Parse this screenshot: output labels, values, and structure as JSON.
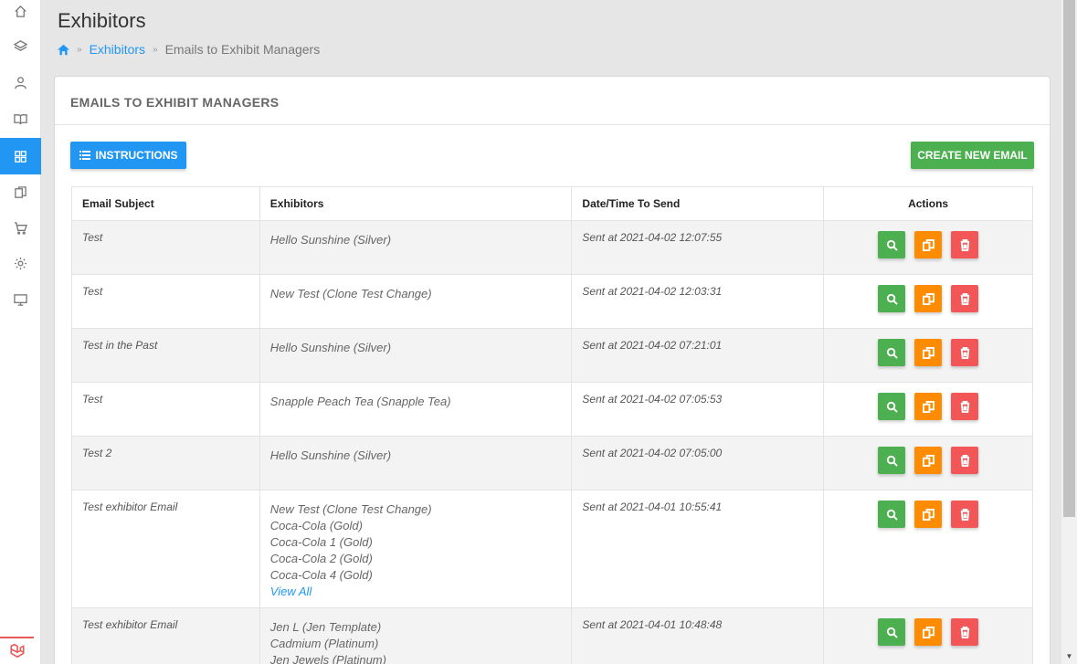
{
  "header": {
    "title": "Exhibitors",
    "breadcrumb": {
      "section": "Exhibitors",
      "current": "Emails to Exhibit Managers"
    }
  },
  "sidebar": {
    "items": [
      {
        "icon": "home-icon"
      },
      {
        "icon": "layers-icon"
      },
      {
        "icon": "user-icon"
      },
      {
        "icon": "book-icon"
      },
      {
        "icon": "grid-icon",
        "active": true
      },
      {
        "icon": "copy-icon"
      },
      {
        "icon": "cart-icon"
      },
      {
        "icon": "gear-icon"
      },
      {
        "icon": "monitor-icon"
      }
    ],
    "logo": "laravel-logo-icon"
  },
  "card": {
    "title": "EMAILS TO EXHIBIT MANAGERS",
    "instructions_label": "INSTRUCTIONS",
    "create_label": "CREATE NEW EMAIL"
  },
  "table": {
    "columns": [
      "Email Subject",
      "Exhibitors",
      "Date/Time To Send",
      "Actions"
    ],
    "rows": [
      {
        "subject": "Test",
        "exhibitors": [
          "Hello Sunshine (Silver)"
        ],
        "sent": "Sent at 2021-04-02 12:07:55"
      },
      {
        "subject": "Test",
        "exhibitors": [
          "New Test (Clone Test Change)"
        ],
        "sent": "Sent at 2021-04-02 12:03:31"
      },
      {
        "subject": "Test in the Past",
        "exhibitors": [
          "Hello Sunshine (Silver)"
        ],
        "sent": "Sent at 2021-04-02 07:21:01"
      },
      {
        "subject": "Test",
        "exhibitors": [
          "Snapple Peach Tea (Snapple Tea)"
        ],
        "sent": "Sent at 2021-04-02 07:05:53"
      },
      {
        "subject": "Test 2",
        "exhibitors": [
          "Hello Sunshine (Silver)"
        ],
        "sent": "Sent at 2021-04-02 07:05:00"
      },
      {
        "subject": "Test exhibitor Email",
        "exhibitors": [
          "New Test (Clone Test Change)",
          "Coca-Cola (Gold)",
          "Coca-Cola 1 (Gold)",
          "Coca-Cola 2 (Gold)",
          "Coca-Cola 4 (Gold)"
        ],
        "view_all": "View All",
        "sent": "Sent at 2021-04-01 10:55:41"
      },
      {
        "subject": "Test exhibitor Email",
        "exhibitors": [
          "Jen L (Jen Template)",
          "Cadmium (Platinum)",
          "Jen Jewels (Platinum)"
        ],
        "sent": "Sent at 2021-04-01 10:48:48"
      }
    ]
  },
  "colors": {
    "primary": "#2196f3",
    "success": "#4caf50",
    "warning": "#ff8c00",
    "danger": "#f25656"
  }
}
